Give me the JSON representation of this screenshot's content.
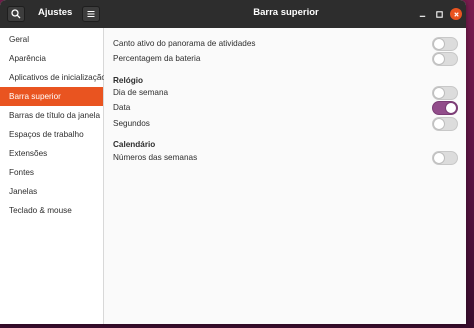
{
  "window": {
    "app_title": "Ajustes",
    "page_title": "Barra superior"
  },
  "sidebar": {
    "items": [
      {
        "label": "Geral",
        "active": false
      },
      {
        "label": "Aparência",
        "active": false
      },
      {
        "label": "Aplicativos de inicialização",
        "active": false
      },
      {
        "label": "Barra superior",
        "active": true
      },
      {
        "label": "Barras de título da janela",
        "active": false
      },
      {
        "label": "Espaços de trabalho",
        "active": false
      },
      {
        "label": "Extensões",
        "active": false
      },
      {
        "label": "Fontes",
        "active": false
      },
      {
        "label": "Janelas",
        "active": false
      },
      {
        "label": "Teclado & mouse",
        "active": false
      }
    ]
  },
  "main": {
    "general": [
      {
        "label": "Canto ativo do panorama de atividades",
        "enabled": false
      },
      {
        "label": "Percentagem da bateria",
        "enabled": false
      }
    ],
    "clock_section": "Relógio",
    "clock": [
      {
        "label": "Dia de semana",
        "enabled": false
      },
      {
        "label": "Data",
        "enabled": true
      },
      {
        "label": "Segundos",
        "enabled": false
      }
    ],
    "calendar_section": "Calendário",
    "calendar": [
      {
        "label": "Números das semanas",
        "enabled": false
      }
    ]
  },
  "colors": {
    "accent": "#e95420",
    "toggle_on": "#924d8b",
    "titlebar": "#2d2d2d"
  }
}
